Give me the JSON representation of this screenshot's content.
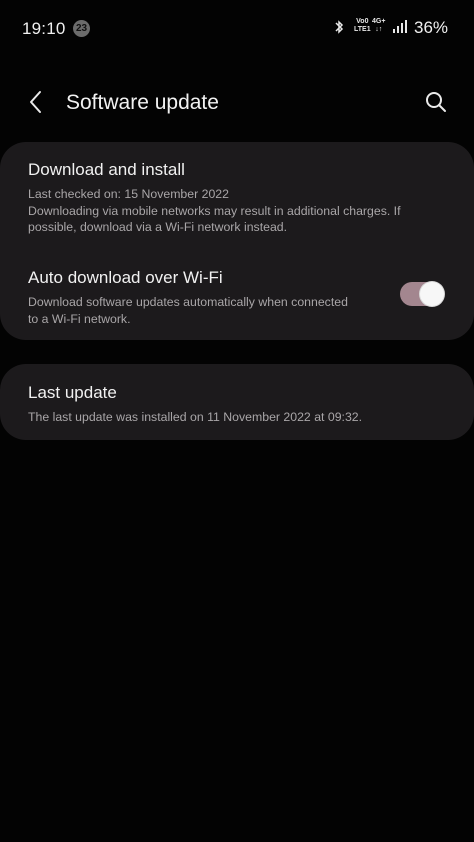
{
  "status_bar": {
    "time": "19:10",
    "notification_count": "23",
    "volte_label_top": "Vo0",
    "volte_label_bottom": "LTE1",
    "network_label_top": "4G+",
    "network_label_bottom": "↓↑",
    "battery_percent": "36%",
    "icons": [
      "bluetooth-icon",
      "signal-icon"
    ]
  },
  "header": {
    "title": "Software update",
    "back_icon": "chevron-left-icon",
    "search_icon": "search-icon"
  },
  "settings": {
    "download_install": {
      "title": "Download and install",
      "last_checked": "Last checked on: 15 November 2022",
      "description": "Downloading via mobile networks may result in additional charges. If possible, download via a Wi-Fi network instead."
    },
    "auto_download": {
      "title": "Auto download over Wi-Fi",
      "description": "Download software updates automatically when connected to a Wi-Fi network.",
      "enabled": true
    },
    "last_update": {
      "title": "Last update",
      "description": "The last update was installed on 11 November 2022 at 09:32."
    }
  },
  "colors": {
    "background": "#030303",
    "card": "#1c1a1c",
    "toggle_track": "#a3868f",
    "toggle_knob": "#f7f7f7",
    "secondary_text": "#a9a6a8"
  }
}
